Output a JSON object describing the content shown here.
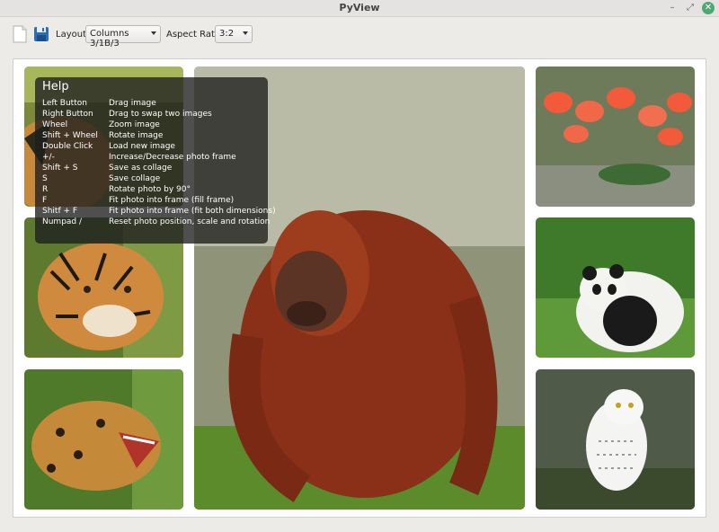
{
  "window": {
    "title": "PyView"
  },
  "window_controls": {
    "minimize": "–",
    "maximize": "⤢",
    "close": "✕"
  },
  "toolbar": {
    "layout_label": "Layout:",
    "layout_value": "Columns 3/1B/3",
    "aspect_label": "Aspect Ratio:",
    "aspect_value": "3:2"
  },
  "photos": [
    {
      "subject": "tiger",
      "position": "left column, top"
    },
    {
      "subject": "tiger",
      "position": "left column, middle"
    },
    {
      "subject": "jaguar",
      "position": "left column, bottom"
    },
    {
      "subject": "orangutan",
      "position": "center, big"
    },
    {
      "subject": "flamingos",
      "position": "right column, top"
    },
    {
      "subject": "panda",
      "position": "right column, middle"
    },
    {
      "subject": "snowy owl",
      "position": "right column, bottom"
    }
  ],
  "help": {
    "title": "Help",
    "rows": [
      {
        "key": "Left Button",
        "action": "Drag image"
      },
      {
        "key": "Right Button",
        "action": "Drag to swap two images"
      },
      {
        "key": "Wheel",
        "action": "Zoom image"
      },
      {
        "key": "Shift + Wheel",
        "action": "Rotate image"
      },
      {
        "key": "Double Click",
        "action": "Load new image"
      },
      {
        "key": "+/-",
        "action": "Increase/Decrease photo frame"
      },
      {
        "key": "Shift + S",
        "action": "Save as collage"
      },
      {
        "key": "S",
        "action": "Save collage"
      },
      {
        "key": "R",
        "action": "Rotate photo by 90°"
      },
      {
        "key": "F",
        "action": "Fit photo into frame (fill frame)"
      },
      {
        "key": "Shitf + F",
        "action": "Fit photo into frame (fit both dimensions)"
      },
      {
        "key": "Numpad /",
        "action": "Reset photo position, scale and rotation"
      }
    ]
  },
  "icons": {
    "new": "new-document-icon",
    "save": "save-floppy-icon"
  }
}
